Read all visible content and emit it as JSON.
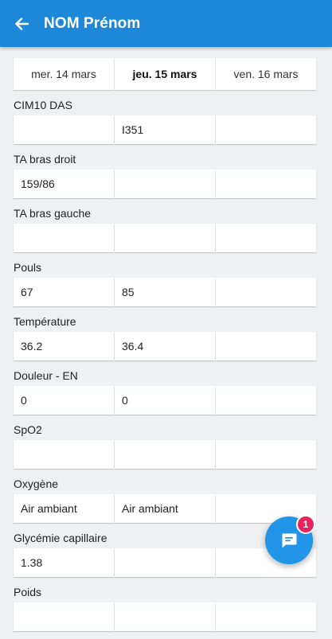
{
  "header": {
    "title": "NOM Prénom",
    "back_icon": "arrow-left-icon",
    "bg_color": "#1e88d8"
  },
  "dates": [
    "mer. 14 mars",
    "jeu. 15 mars",
    "ven. 16 mars"
  ],
  "selected_date_index": 1,
  "sections": [
    {
      "label": "CIM10 DAS",
      "values": [
        "",
        "I351",
        ""
      ]
    },
    {
      "label": "TA bras droit",
      "values": [
        "159/86",
        "",
        ""
      ]
    },
    {
      "label": "TA bras gauche",
      "values": [
        "",
        "",
        ""
      ]
    },
    {
      "label": "Pouls",
      "values": [
        "67",
        "85",
        ""
      ]
    },
    {
      "label": "Température",
      "values": [
        "36.2",
        "36.4",
        ""
      ]
    },
    {
      "label": "Douleur - EN",
      "values": [
        "0",
        "0",
        ""
      ]
    },
    {
      "label": "SpO2",
      "values": [
        "",
        "",
        ""
      ]
    },
    {
      "label": "Oxygène",
      "values": [
        "Air ambiant",
        "Air ambiant",
        ""
      ]
    },
    {
      "label": "Glycémie capillaire",
      "values": [
        "1.38",
        "",
        ""
      ]
    },
    {
      "label": "Poids",
      "values": [
        "",
        "",
        ""
      ]
    }
  ],
  "fab": {
    "icon": "chat-icon",
    "badge": "1",
    "color": "#2196e8",
    "badge_color": "#e8245f"
  }
}
